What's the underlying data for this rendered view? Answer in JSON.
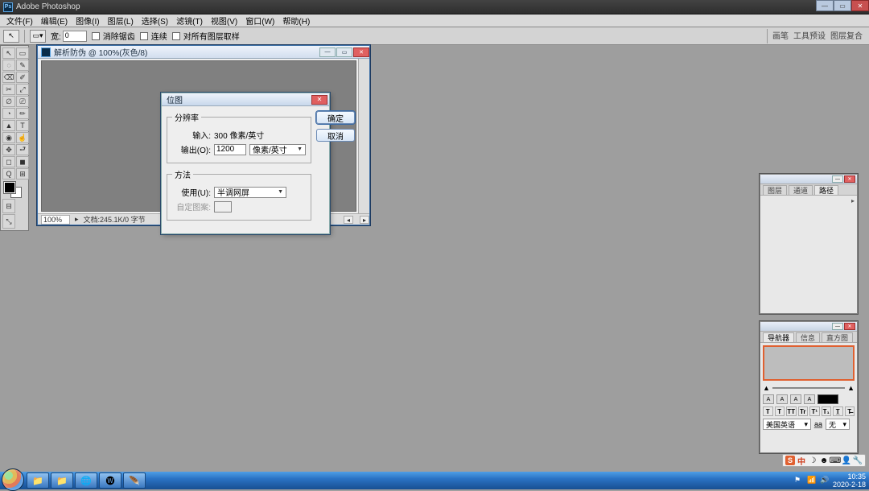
{
  "app": {
    "title": "Adobe Photoshop"
  },
  "menu": [
    "文件(F)",
    "编辑(E)",
    "图像(I)",
    "图层(L)",
    "选择(S)",
    "滤镜(T)",
    "视图(V)",
    "窗口(W)",
    "帮助(H)"
  ],
  "options": {
    "tool_hint": "↖",
    "width_label": "宽:",
    "width": "0",
    "label1": "消除锯齿",
    "label2": "连续",
    "label3": "对所有图层取样",
    "r1": "画笔",
    "r2": "工具预设",
    "r3": "图层复合"
  },
  "tools": [
    "↖",
    "▭",
    "◌",
    "✎",
    "⌫",
    "✐",
    "✂",
    "⤢",
    "∅",
    "⎚",
    "◔",
    "✏",
    "▲",
    "T",
    "◉",
    "☝",
    "✥",
    "⮐",
    "◻",
    "◼",
    "Q",
    "⊞",
    "⊟",
    "⤡"
  ],
  "doc": {
    "title": "解析防伪 @ 100%(灰色/8)",
    "zoom": "100%",
    "status": "文档:245.1K/0 字节"
  },
  "dialog": {
    "title": "位图",
    "group1": "分辨率",
    "input_label": "输入:",
    "input_value": "300 像素/英寸",
    "output_label": "输出(O):",
    "output_value": "1200",
    "output_unit": "像素/英寸",
    "group2": "方法",
    "use_label": "使用(U):",
    "use_value": "半调网屏",
    "custom_label": "自定图案:",
    "ok": "确定",
    "cancel": "取消"
  },
  "panel_layers": {
    "tabs": [
      "图层",
      "通道",
      "路径"
    ]
  },
  "panel_char": {
    "tabs": [
      "导航器",
      "信息",
      "直方图"
    ],
    "style_btns": [
      "T",
      "T",
      "TT",
      "Tr",
      "T¹",
      "T₁",
      "T̲",
      "T̶"
    ],
    "lang": "美国英语",
    "aa_label": "a̲a̲",
    "aa": "无"
  },
  "ime": {
    "engine": "S",
    "lang": "中"
  },
  "taskbar": {
    "apps": [
      "📁",
      "🌐",
      "🅦",
      "🪶"
    ],
    "time": "10:35",
    "date": "2020-2-18"
  }
}
